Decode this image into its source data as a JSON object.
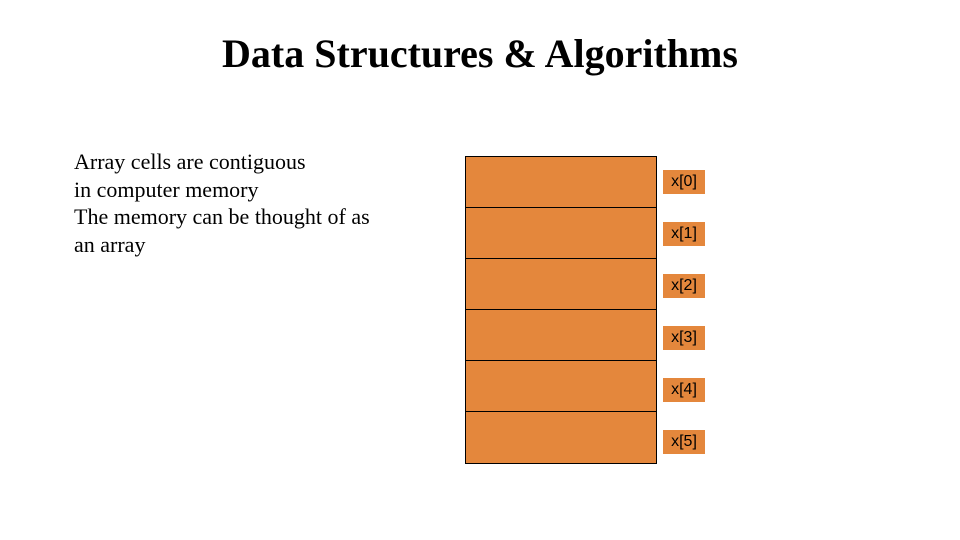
{
  "title": "Data Structures & Algorithms",
  "body": "Array cells are contiguous\n in computer memory\nThe memory can be thought of as an array",
  "cells": [
    {
      "label": "x[0]"
    },
    {
      "label": "x[1]"
    },
    {
      "label": "x[2]"
    },
    {
      "label": "x[3]"
    },
    {
      "label": "x[4]"
    },
    {
      "label": "x[5]"
    }
  ],
  "colors": {
    "cell_fill": "#e4873c"
  }
}
